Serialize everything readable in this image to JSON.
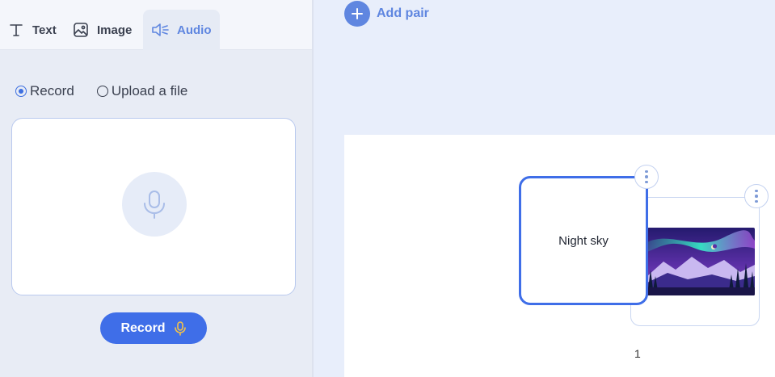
{
  "tabs": [
    {
      "label": "Text",
      "icon": "text-icon"
    },
    {
      "label": "Image",
      "icon": "image-icon"
    },
    {
      "label": "Audio",
      "icon": "audio-icon",
      "active": true
    }
  ],
  "audio_source": {
    "options": [
      "Record",
      "Upload a file"
    ],
    "selected": "Record"
  },
  "record_button": {
    "label": "Record",
    "icon": "microphone-icon"
  },
  "add_pair": {
    "label": "Add pair",
    "icon": "plus-icon"
  },
  "pair_card": {
    "front_text": "Night sky",
    "back_image": "aurora-night-sky-image"
  },
  "page_number": "1",
  "colors": {
    "accent": "#3f6ee8",
    "accent_light": "#5f86e0",
    "panel_bg": "#e8ecf5",
    "canvas_bg": "#ffffff"
  }
}
